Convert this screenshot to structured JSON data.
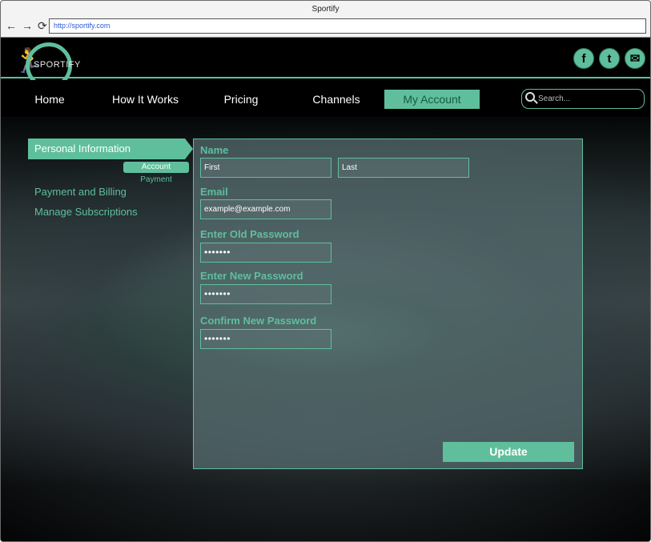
{
  "window": {
    "title": "Sportify",
    "url": "http://sportify.com"
  },
  "browser": {
    "back_glyph": "←",
    "forward_glyph": "→",
    "reload_glyph": "⟳"
  },
  "logo": {
    "text": "SPORTIFY",
    "figure_glyph": "🏃"
  },
  "social": [
    {
      "icon": "facebook-icon",
      "glyph": "f"
    },
    {
      "icon": "twitter-icon",
      "glyph": "t"
    },
    {
      "icon": "mail-icon",
      "glyph": "✉"
    }
  ],
  "nav": {
    "items": [
      {
        "label": "Home"
      },
      {
        "label": "How It Works"
      },
      {
        "label": "Pricing"
      },
      {
        "label": "Channels"
      },
      {
        "label": "My Account"
      }
    ],
    "search_placeholder": "Search..."
  },
  "sidebar": {
    "active": "Personal Information",
    "sub_items": [
      "Account",
      "Payment"
    ],
    "items": [
      "Payment and Billing",
      "Manage Subscriptions"
    ]
  },
  "form": {
    "name_label": "Name",
    "first": "First",
    "last": "Last",
    "email_label": "Email",
    "email": "example@example.com",
    "old_pw_label": "Enter Old Password",
    "old_pw": "•••••••",
    "new_pw_label": "Enter New Password",
    "new_pw": "•••••••",
    "confirm_pw_label": "Confirm New Password",
    "confirm_pw": "•••••••",
    "update_label": "Update"
  },
  "colors": {
    "accent": "#5fbf9d",
    "header_bg": "#000000",
    "panel_bg": "#586e70"
  }
}
